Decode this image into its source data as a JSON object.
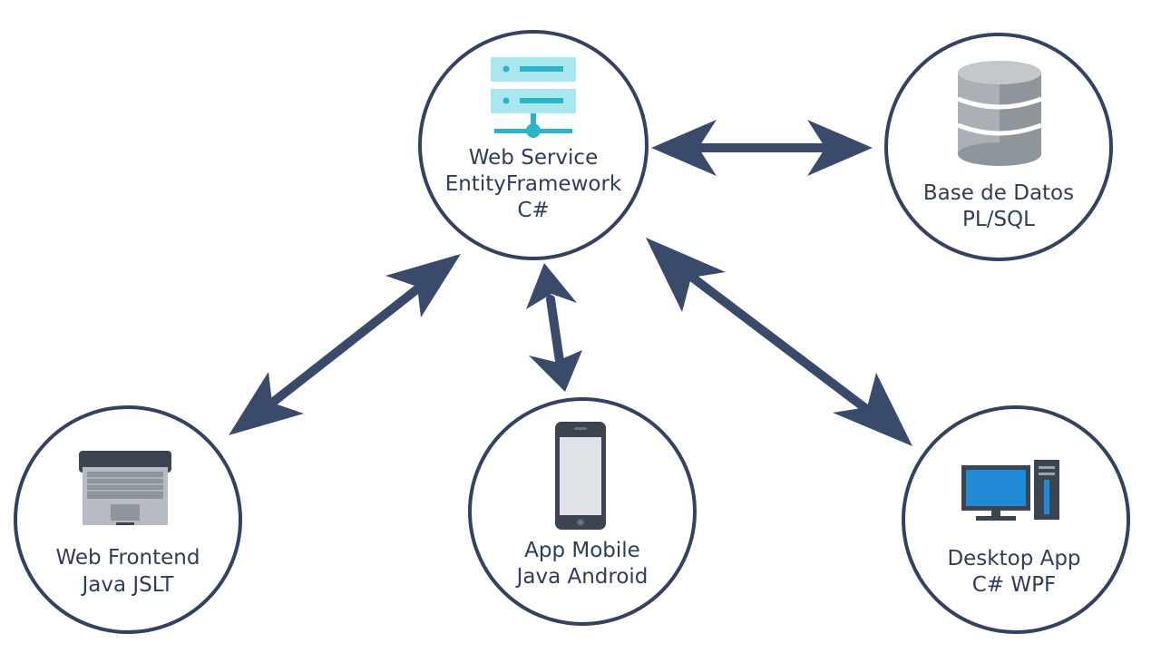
{
  "colors": {
    "stroke": "#34425f",
    "arrow": "#3a4a6b",
    "text": "#2f3d5a",
    "server_light": "#a8e7ee",
    "server_accent": "#2bb3c7",
    "db_body": "#aab0b5",
    "device_dark": "#3b4450",
    "screen_light": "#dfe3e8",
    "monitor_blue": "#1f8ad6"
  },
  "nodes": {
    "web_service": {
      "icon": "server-icon",
      "lines": [
        "Web Service",
        "EntityFramework",
        "C#"
      ]
    },
    "database": {
      "icon": "database-icon",
      "lines": [
        "Base de Datos",
        "PL/SQL"
      ]
    },
    "web_frontend": {
      "icon": "laptop-icon",
      "lines": [
        "Web Frontend",
        "Java JSLT"
      ]
    },
    "app_mobile": {
      "icon": "smartphone-icon",
      "lines": [
        "App Mobile",
        "Java Android"
      ]
    },
    "desktop_app": {
      "icon": "desktop-computer-icon",
      "lines": [
        "Desktop App",
        "C# WPF"
      ]
    }
  },
  "connections": [
    {
      "from": "web_service",
      "to": "database",
      "bidirectional": true
    },
    {
      "from": "web_service",
      "to": "web_frontend",
      "bidirectional": true
    },
    {
      "from": "web_service",
      "to": "app_mobile",
      "bidirectional": true
    },
    {
      "from": "web_service",
      "to": "desktop_app",
      "bidirectional": true
    }
  ]
}
